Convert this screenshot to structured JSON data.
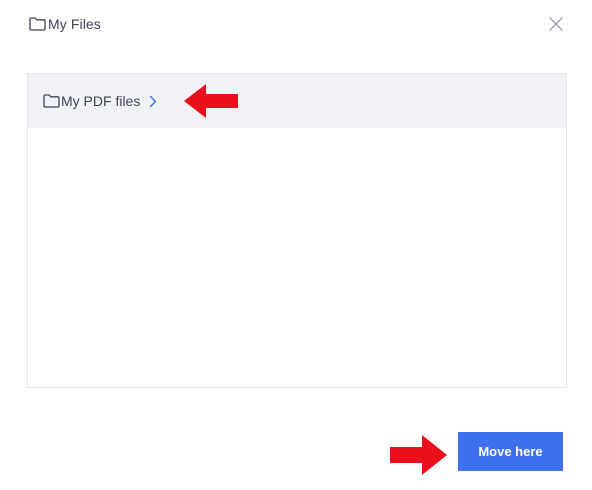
{
  "dialog": {
    "title": "My Files",
    "title_icon": "folder-icon",
    "close_icon": "close-icon"
  },
  "folder_list": {
    "items": [
      {
        "label": "My PDF files",
        "icon": "folder-icon",
        "chevron_icon": "chevron-right-icon"
      }
    ]
  },
  "footer": {
    "move_label": "Move here"
  },
  "annotations": {
    "arrow_icon": "red-arrow-icon",
    "arrow_color": "#e8111b"
  },
  "colors": {
    "accent": "#3f70f0",
    "row_highlight": "#f1f2f6",
    "text": "#3c4257",
    "chevron": "#3f70f0"
  }
}
